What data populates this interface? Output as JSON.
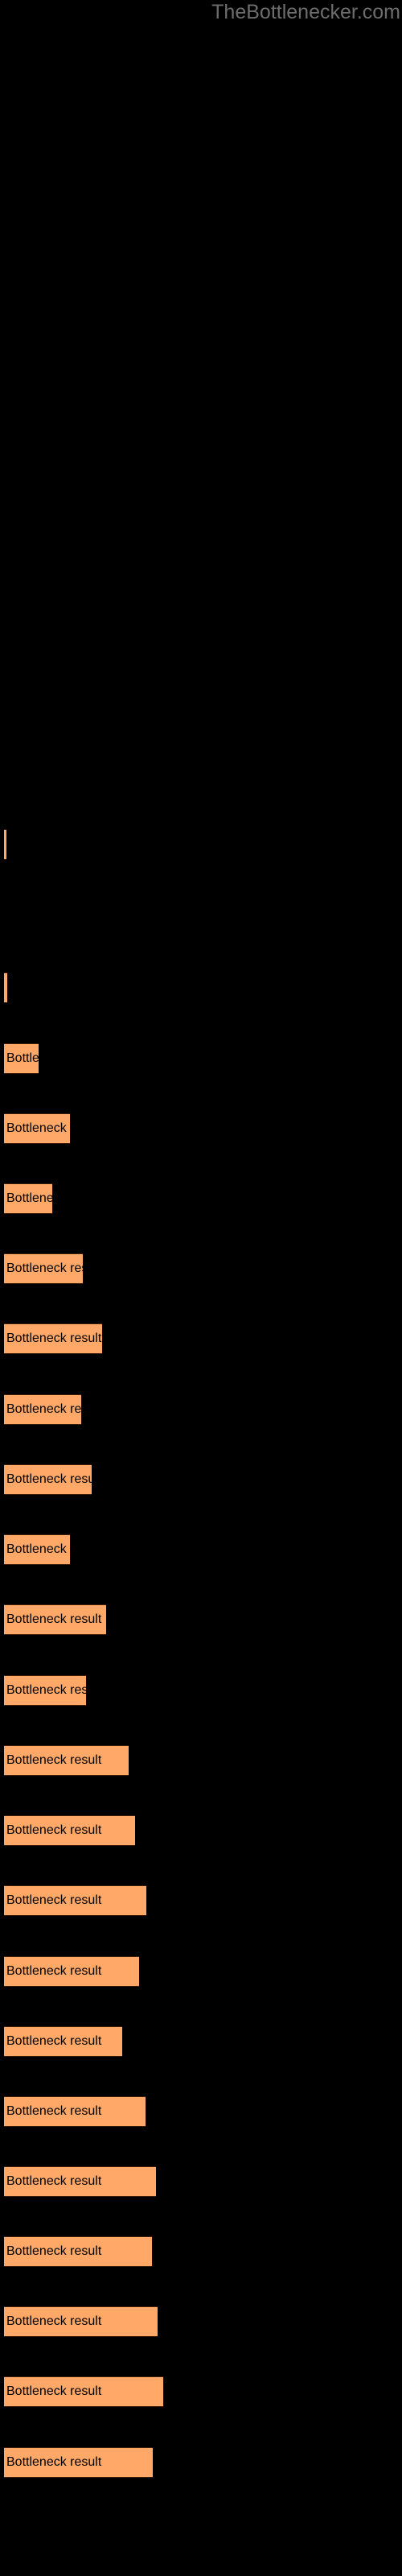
{
  "header": {
    "site_title": "TheBottlenecker.com",
    "title_color": "#6d6d6d"
  },
  "theme": {
    "background": "#000000",
    "bar_fill": "#ffa868",
    "bar_edge": "#3c1d0c",
    "label_color": "#000000"
  },
  "chart_data": {
    "type": "bar",
    "orientation": "horizontal",
    "title": "",
    "subtitle": "",
    "xlabel": "",
    "ylabel": "",
    "grid": false,
    "legend": null,
    "bar_label_text": "Bottleneck result",
    "note": "Horizontal bar chart on a black background; every bar carries the same in-bar caption 'Bottleneck result', clipped to the bar width.",
    "xlim": [
      0,
      200
    ],
    "categories": [
      "Bottleneck result",
      "Bottleneck result",
      "Bottleneck result",
      "Bottleneck result",
      "Bottleneck result",
      "Bottleneck result",
      "Bottleneck result",
      "Bottleneck result",
      "Bottleneck result",
      "Bottleneck result",
      "Bottleneck result",
      "Bottleneck result",
      "Bottleneck result",
      "Bottleneck result",
      "Bottleneck result",
      "Bottleneck result",
      "Bottleneck result",
      "Bottleneck result",
      "Bottleneck result",
      "Bottleneck result",
      "Bottleneck result",
      "Bottleneck result",
      "Bottleneck result"
    ],
    "values": [
      3,
      4,
      43,
      82,
      60,
      98,
      122,
      96,
      109,
      82,
      127,
      102,
      155,
      163,
      177,
      168,
      147,
      176,
      189,
      184,
      191,
      198,
      185
    ],
    "bars": [
      {
        "label": "Bottleneck result",
        "value": 3,
        "top": 1030
      },
      {
        "label": "Bottleneck result",
        "value": 4,
        "top": 1208
      },
      {
        "label": "Bottleneck result",
        "value": 43,
        "top": 1296
      },
      {
        "label": "Bottleneck result",
        "value": 82,
        "top": 1383
      },
      {
        "label": "Bottleneck result",
        "value": 60,
        "top": 1470
      },
      {
        "label": "Bottleneck result",
        "value": 98,
        "top": 1557
      },
      {
        "label": "Bottleneck result",
        "value": 122,
        "top": 1644
      },
      {
        "label": "Bottleneck result",
        "value": 96,
        "top": 1732
      },
      {
        "label": "Bottleneck result",
        "value": 109,
        "top": 1819
      },
      {
        "label": "Bottleneck result",
        "value": 82,
        "top": 1906
      },
      {
        "label": "Bottleneck result",
        "value": 127,
        "top": 1993
      },
      {
        "label": "Bottleneck result",
        "value": 102,
        "top": 2081
      },
      {
        "label": "Bottleneck result",
        "value": 155,
        "top": 2168
      },
      {
        "label": "Bottleneck result",
        "value": 163,
        "top": 2255
      },
      {
        "label": "Bottleneck result",
        "value": 177,
        "top": 2342
      },
      {
        "label": "Bottleneck result",
        "value": 168,
        "top": 2430
      },
      {
        "label": "Bottleneck result",
        "value": 147,
        "top": 2517
      },
      {
        "label": "Bottleneck result",
        "value": 176,
        "top": 2604
      },
      {
        "label": "Bottleneck result",
        "value": 189,
        "top": 2691
      },
      {
        "label": "Bottleneck result",
        "value": 184,
        "top": 2778
      },
      {
        "label": "Bottleneck result",
        "value": 191,
        "top": 2865
      },
      {
        "label": "Bottleneck result",
        "value": 198,
        "top": 2952
      },
      {
        "label": "Bottleneck result",
        "value": 185,
        "top": 3040
      }
    ]
  }
}
